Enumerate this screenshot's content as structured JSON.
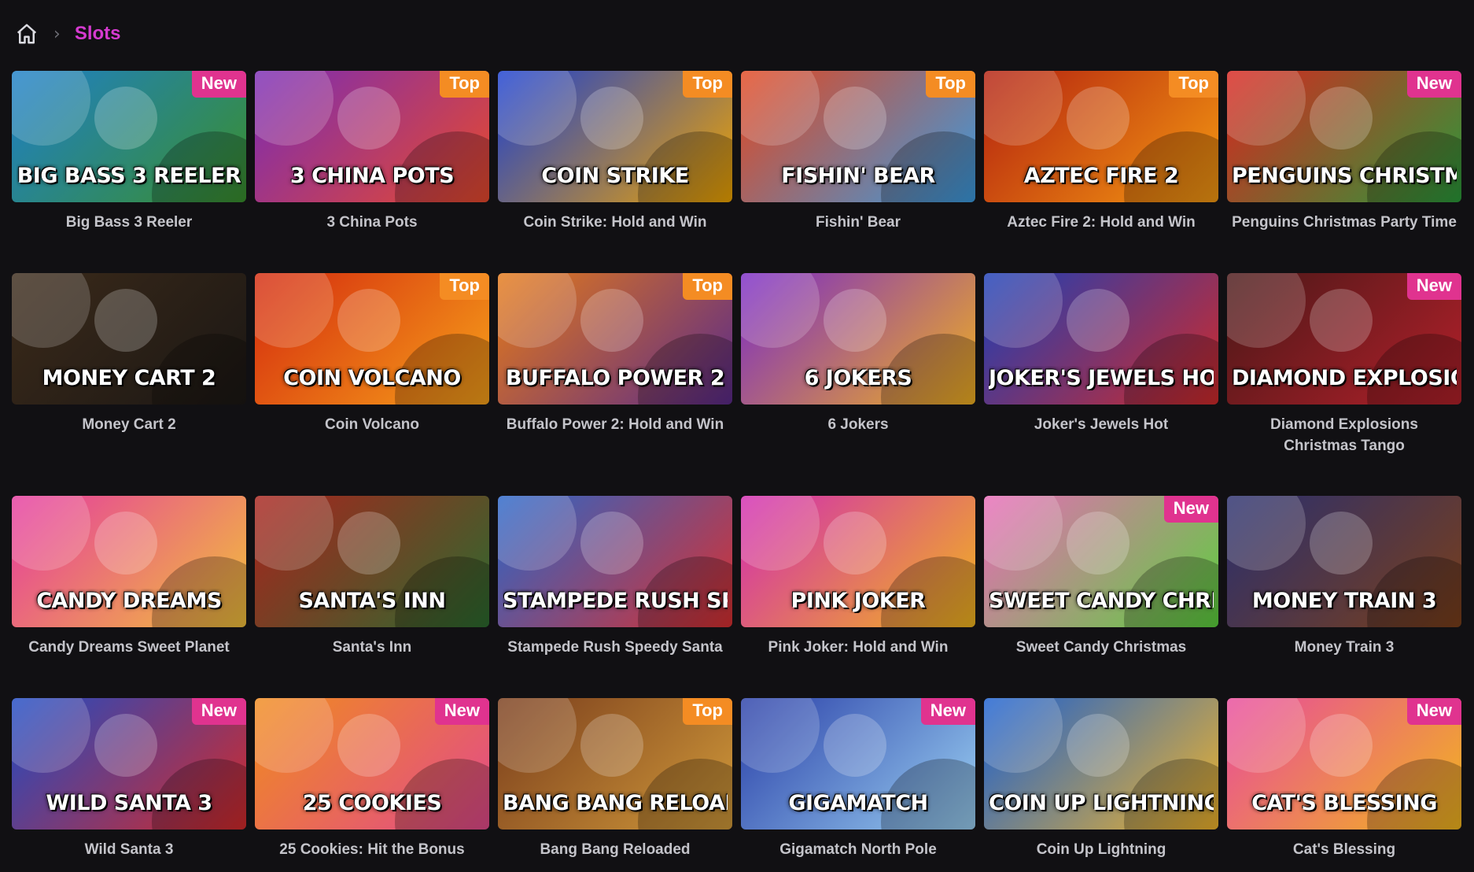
{
  "breadcrumb": {
    "home_icon": "home-icon",
    "separator_icon": "chevron-right-icon",
    "current": "Slots"
  },
  "colors": {
    "accent": "#d63ad0",
    "badge_new": "#e0338f",
    "badge_top": "#f48c23",
    "background": "#111013"
  },
  "games": [
    {
      "title": "Big Bass 3 Reeler",
      "logo": "BIG BASS 3 REELER",
      "badge": "New",
      "c1": "#1e7fc9",
      "c2": "#3a8f2c"
    },
    {
      "title": "3 China Pots",
      "logo": "3 CHINA POTS",
      "badge": "Top",
      "c1": "#7a2bb5",
      "c2": "#e84a2c"
    },
    {
      "title": "Coin Strike: Hold and Win",
      "logo": "COIN STRIKE",
      "badge": "Top",
      "c1": "#1a3fd1",
      "c2": "#f0a500"
    },
    {
      "title": "Fishin' Bear",
      "logo": "FISHIN' BEAR",
      "badge": "Top",
      "c1": "#e2461f",
      "c2": "#3a9be0"
    },
    {
      "title": "Aztec Fire 2: Hold and Win",
      "logo": "AZTEC FIRE 2",
      "badge": "Top",
      "c1": "#b3200f",
      "c2": "#f59a12"
    },
    {
      "title": "Penguins Christmas Party Time",
      "logo": "PENGUINS CHRISTMAS",
      "badge": "New",
      "c1": "#d9251f",
      "c2": "#2a9a3a"
    },
    {
      "title": "Money Cart 2",
      "logo": "MONEY CART 2",
      "badge": "",
      "c1": "#3b2a1a",
      "c2": "#1b1714"
    },
    {
      "title": "Coin Volcano",
      "logo": "COIN VOLCANO",
      "badge": "Top",
      "c1": "#d42a0e",
      "c2": "#f7a11a"
    },
    {
      "title": "Buffalo Power 2: Hold and Win",
      "logo": "BUFFALO POWER 2",
      "badge": "Top",
      "c1": "#e57a19",
      "c2": "#5a2a8a"
    },
    {
      "title": "6 Jokers",
      "logo": "6 JOKERS",
      "badge": "",
      "c1": "#7a2ac7",
      "c2": "#f0b020"
    },
    {
      "title": "Joker's Jewels Hot",
      "logo": "JOKER'S JEWELS HOT",
      "badge": "",
      "c1": "#1c3fb7",
      "c2": "#d12a2a"
    },
    {
      "title": "Diamond Explosions Christmas Tango",
      "logo": "DIAMOND EXPLOSIONS",
      "badge": "New",
      "c1": "#4a1818",
      "c2": "#b3202a"
    },
    {
      "title": "Candy Dreams Sweet Planet",
      "logo": "CANDY DREAMS",
      "badge": "",
      "c1": "#e53aa0",
      "c2": "#f2c13a"
    },
    {
      "title": "Santa's Inn",
      "logo": "SANTA'S INN",
      "badge": "",
      "c1": "#a8231d",
      "c2": "#2c6b2f"
    },
    {
      "title": "Stampede Rush Speedy Santa",
      "logo": "STAMPEDE RUSH SPEEDY SANTA",
      "badge": "",
      "c1": "#2a66c9",
      "c2": "#d93030"
    },
    {
      "title": "Pink Joker: Hold and Win",
      "logo": "PINK JOKER",
      "badge": "",
      "c1": "#d12bb2",
      "c2": "#f2b61c"
    },
    {
      "title": "Sweet Candy Christmas",
      "logo": "SWEET CANDY CHRISTMAS",
      "badge": "New",
      "c1": "#e86ab8",
      "c2": "#5bd13c"
    },
    {
      "title": "Money Train 3",
      "logo": "MONEY TRAIN 3",
      "badge": "",
      "c1": "#2a2f6e",
      "c2": "#7a3f1a"
    },
    {
      "title": "Wild Santa 3",
      "logo": "WILD SANTA 3",
      "badge": "New",
      "c1": "#1f4bc4",
      "c2": "#d42a2a"
    },
    {
      "title": "25 Cookies: Hit the Bonus",
      "logo": "25 COOKIES",
      "badge": "New",
      "c1": "#f08b1e",
      "c2": "#e24a8c"
    },
    {
      "title": "Bang Bang Reloaded",
      "logo": "BANG BANG RELOADED",
      "badge": "Top",
      "c1": "#7a3d1c",
      "c2": "#d19a3a"
    },
    {
      "title": "Gigamatch North Pole",
      "logo": "GIGAMATCH",
      "badge": "New",
      "c1": "#2a3fa8",
      "c2": "#9ad0f2"
    },
    {
      "title": "Coin Up Lightning",
      "logo": "COIN UP LIGHTNING",
      "badge": "",
      "c1": "#1a5fd1",
      "c2": "#f0b42a"
    },
    {
      "title": "Cat's Blessing",
      "logo": "CAT'S BLESSING",
      "badge": "New",
      "c1": "#e84a9c",
      "c2": "#f2b61c"
    }
  ]
}
